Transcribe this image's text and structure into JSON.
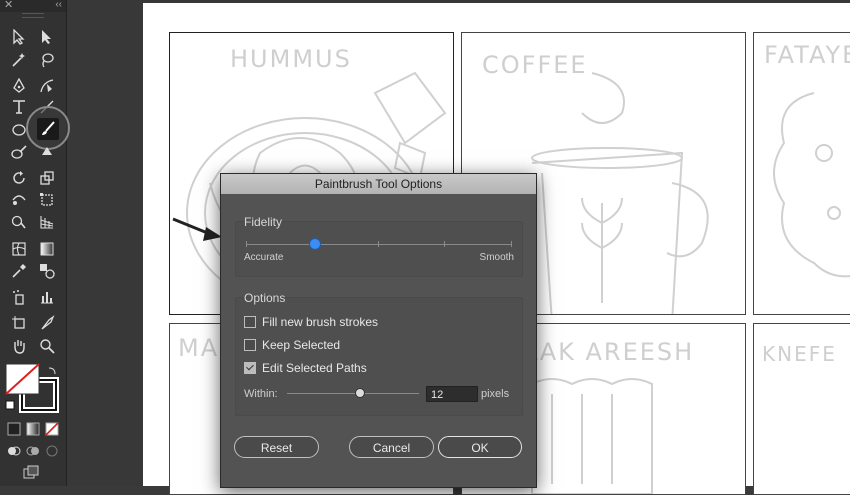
{
  "toolbar": {
    "close_glyph": "✕",
    "collapse_glyph": "‹‹",
    "tools": [
      "selection-tool",
      "direct-selection-tool",
      "magic-wand-tool",
      "lasso-tool",
      "pen-tool",
      "curvature-tool",
      "type-tool",
      "paintbrush-tool",
      "shape-tool",
      "shaper-tool",
      "rotate-tool",
      "scale-tool",
      "puppet-warp-tool",
      "free-transform-tool",
      "shape-builder-tool",
      "perspective-tool",
      "mesh-tool",
      "gradient-tool",
      "eyedropper-tool",
      "blend-tool",
      "symbol-sprayer-tool",
      "graph-tool",
      "artboard-tool",
      "slice-tool",
      "hand-tool",
      "zoom-tool"
    ]
  },
  "artboard": {
    "panels": [
      "HUMMUS",
      "COFFEE",
      "FATAYER",
      "MAN",
      "RAK AREESH",
      "KNEFE"
    ]
  },
  "dialog": {
    "title": "Paintbrush Tool Options",
    "fidelity": {
      "label": "Fidelity",
      "min_label": "Accurate",
      "max_label": "Smooth",
      "value_fraction": 0.26
    },
    "options": {
      "label": "Options",
      "fill_new": {
        "label": "Fill new brush strokes",
        "checked": false
      },
      "keep_selected": {
        "label": "Keep Selected",
        "checked": false
      },
      "edit_selected": {
        "label": "Edit Selected Paths",
        "checked": true
      },
      "within_label": "Within:",
      "within_value": "12",
      "within_unit": "pixels",
      "within_fraction": 0.55
    },
    "buttons": {
      "reset": "Reset",
      "cancel": "Cancel",
      "ok": "OK"
    }
  },
  "colors": {
    "accent": "#3d8cf0",
    "dialog_bg": "#535353",
    "toolbar_bg": "#323232"
  }
}
